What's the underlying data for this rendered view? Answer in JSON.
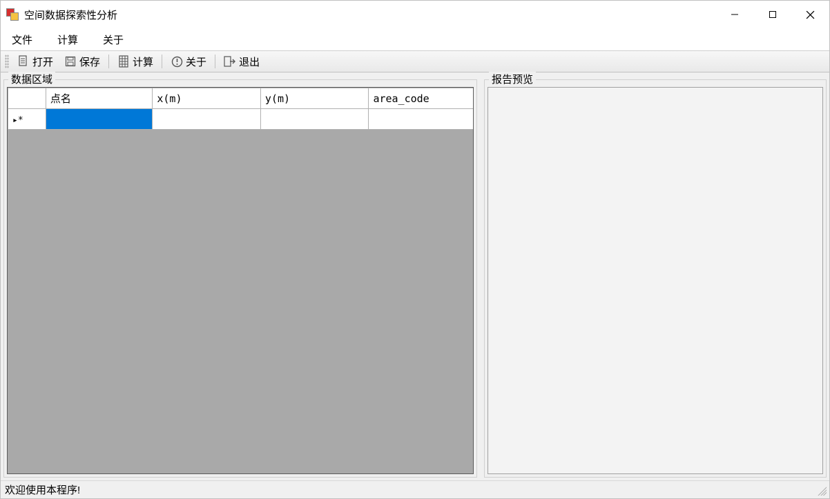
{
  "window": {
    "title": "空间数据探索性分析"
  },
  "menubar": {
    "file": "文件",
    "compute": "计算",
    "about": "关于"
  },
  "toolbar": {
    "open": "打开",
    "save": "保存",
    "compute": "计算",
    "about": "关于",
    "exit": "退出"
  },
  "panels": {
    "data_area_label": "数据区域",
    "report_preview_label": "报告预览"
  },
  "datagrid": {
    "columns": {
      "point_name": "点名",
      "x": "x(m)",
      "y": "y(m)",
      "area_code": "area_code"
    },
    "new_row_glyph": "▸*",
    "rows": []
  },
  "statusbar": {
    "message": "欢迎使用本程序!"
  }
}
